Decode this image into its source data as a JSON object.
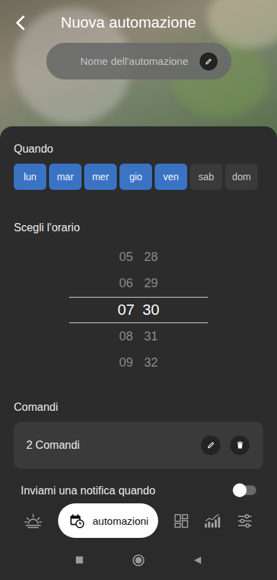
{
  "header": {
    "title": "Nuova automazione"
  },
  "name_field": {
    "placeholder": "Nome dell'automazione"
  },
  "schedule": {
    "label": "Quando",
    "days": [
      {
        "label": "lun",
        "selected": true
      },
      {
        "label": "mar",
        "selected": true
      },
      {
        "label": "mer",
        "selected": true
      },
      {
        "label": "gio",
        "selected": true
      },
      {
        "label": "ven",
        "selected": true
      },
      {
        "label": "sab",
        "selected": false
      },
      {
        "label": "dom",
        "selected": false
      }
    ]
  },
  "time": {
    "label": "Scegli l'orario",
    "hours": [
      {
        "value": "05",
        "selected": false
      },
      {
        "value": "06",
        "selected": false
      },
      {
        "value": "07",
        "selected": true
      },
      {
        "value": "08",
        "selected": false
      },
      {
        "value": "09",
        "selected": false
      }
    ],
    "minutes": [
      {
        "value": "28",
        "selected": false
      },
      {
        "value": "29",
        "selected": false
      },
      {
        "value": "30",
        "selected": true
      },
      {
        "value": "31",
        "selected": false
      },
      {
        "value": "32",
        "selected": false
      }
    ]
  },
  "commands": {
    "label": "Comandi",
    "summary": "2 Comandi"
  },
  "notification": {
    "label": "Inviami una notifica quando",
    "on": false
  },
  "nav": [
    {
      "kind": "sun",
      "label": "",
      "selected": false
    },
    {
      "kind": "calendar",
      "label": "automazioni",
      "selected": true
    },
    {
      "kind": "grid",
      "label": "",
      "selected": false
    },
    {
      "kind": "chart",
      "label": "",
      "selected": false
    },
    {
      "kind": "sliders",
      "label": "",
      "selected": false
    }
  ]
}
